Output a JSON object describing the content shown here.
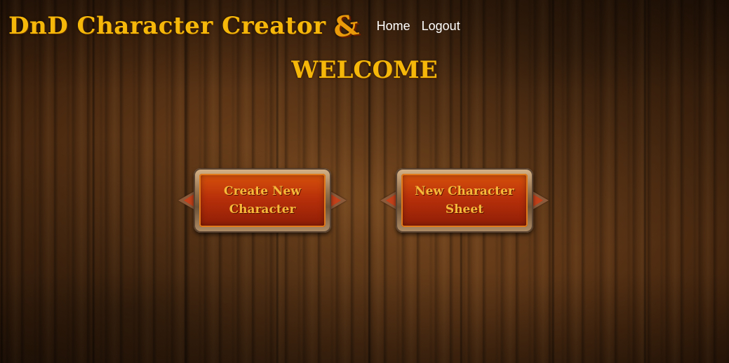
{
  "header": {
    "site_title": "DnD Character Creator",
    "logo_glyph": "&",
    "nav": [
      {
        "label": "Home"
      },
      {
        "label": "Logout"
      }
    ]
  },
  "main": {
    "heading": "WELCOME",
    "buttons": [
      {
        "label": "Create New\nCharacter"
      },
      {
        "label": "New Character\nSheet"
      }
    ]
  },
  "colors": {
    "title_gold": "#f5b80a",
    "button_red": "#b8300a",
    "button_text": "#f7b93a",
    "nav_text": "#ffffff",
    "wood_brown": "#5e3616"
  }
}
